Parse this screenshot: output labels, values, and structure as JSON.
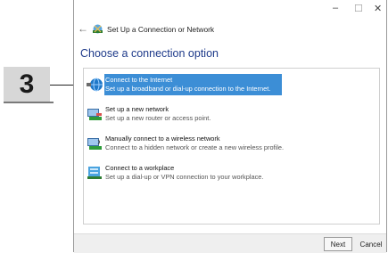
{
  "callout": {
    "number": "3"
  },
  "window": {
    "controls": {
      "minimize": "–",
      "maximize": "☐",
      "close": "✕"
    },
    "back": "←",
    "title": "Set Up a Connection or Network",
    "heading": "Choose a connection option"
  },
  "options": [
    {
      "title": "Connect to the Internet",
      "desc": "Set up a broadband or dial-up connection to the Internet.",
      "icon": "globe-icon",
      "selected": true
    },
    {
      "title": "Set up a new network",
      "desc": "Set up a new router or access point.",
      "icon": "router-icon",
      "selected": false
    },
    {
      "title": "Manually connect to a wireless network",
      "desc": "Connect to a hidden network or create a new wireless profile.",
      "icon": "wireless-icon",
      "selected": false
    },
    {
      "title": "Connect to a workplace",
      "desc": "Set up a dial-up or VPN connection to your workplace.",
      "icon": "workplace-icon",
      "selected": false
    }
  ],
  "footer": {
    "next": "Next",
    "cancel": "Cancel"
  },
  "colors": {
    "selection": "#3c8ed6",
    "heading": "#1e3a8a"
  }
}
